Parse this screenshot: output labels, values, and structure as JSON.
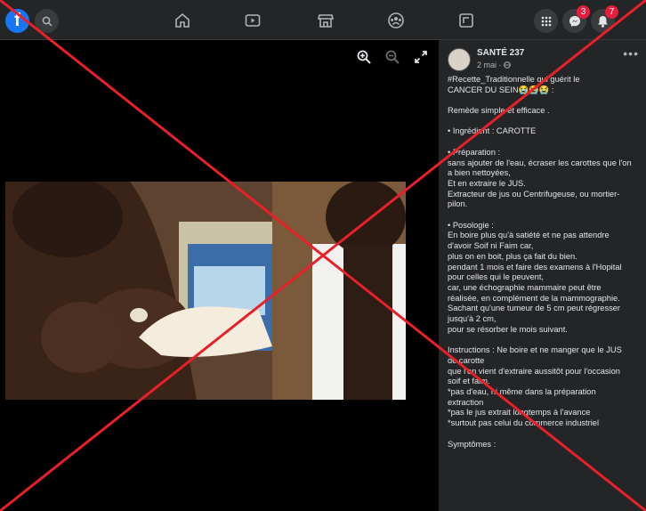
{
  "topbar": {
    "logo_letter": "f",
    "messenger_badge": "3",
    "notifications_badge": "7"
  },
  "post": {
    "page_name": "SANTÉ 237",
    "date": "2 mai · ",
    "lines": [
      "#Recette_Traditionnelle qui guérit le",
      "CANCER DU SEIN😭😭😭 :",
      "",
      "Remède simple et efficace .",
      "",
      "• Ingrédient : CAROTTE",
      "",
      "• Préparation :",
      "sans ajouter de l'eau, écraser les carottes que l'on",
      "a bien nettoyées,",
      "Et en extraire le JUS.",
      "Extracteur de jus ou Centrifugeuse, ou mortier-",
      "pilon.",
      "",
      "• Posologie :",
      "En boire plus qu'à satiété et ne pas attendre",
      "d'avoir Soif ni Faim car,",
      "plus on en boit, plus ça fait du bien.",
      "pendant 1 mois et faire des examens à l'Hopital",
      "pour celles qui le peuvent,",
      "car, une échographie mammaire peut être",
      "réalisée, en complément de la mammographie.",
      "Sachant qu'une tumeur de 5 cm peut régresser",
      "jusqu'à 2 cm,",
      "pour se résorber le mois suivant.",
      "",
      "Instructions : Ne boire et ne manger que le JUS",
      "de carotte",
      "que l'on vient d'extraire aussitôt pour l'occasion",
      "soif et faim.",
      "*pas d'eau, ni même dans la préparation",
      "extraction",
      "*pas le jus extrait longtemps à l'avance",
      "*surtout pas celui du commerce industriel",
      "",
      "Symptômes :"
    ]
  },
  "colors": {
    "topbar_bg": "#242526",
    "panel_bg": "#242526",
    "media_bg": "#000000",
    "cross_red": "#e8202a",
    "badge_red": "#e41e3f",
    "brand_blue": "#1877f2"
  },
  "icons": {
    "nav": [
      "home-icon",
      "watch-icon",
      "marketplace-icon",
      "groups-icon",
      "gaming-icon"
    ],
    "right": [
      "menu-grid-icon",
      "messenger-icon",
      "bell-icon"
    ],
    "viewer": [
      "zoom-in-icon",
      "zoom-out-icon",
      "fullscreen-icon"
    ]
  }
}
